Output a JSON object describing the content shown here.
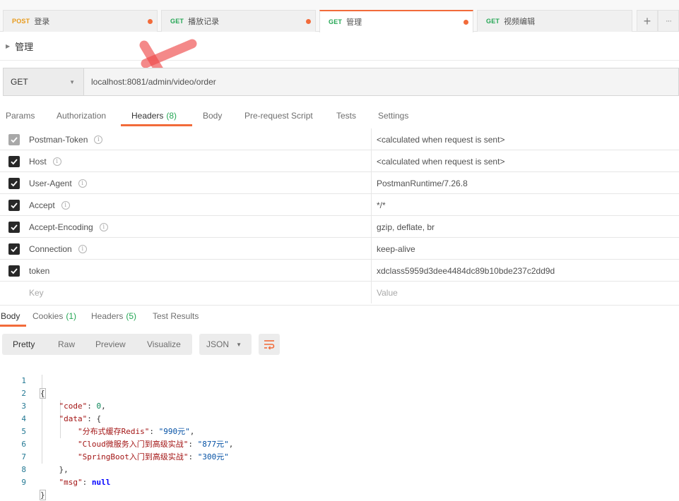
{
  "tabs": [
    {
      "method": "POST",
      "name": "登录",
      "unsaved": true,
      "active": false
    },
    {
      "method": "GET",
      "name": "播放记录",
      "unsaved": true,
      "active": false
    },
    {
      "method": "GET",
      "name": "管理",
      "unsaved": true,
      "active": true
    },
    {
      "method": "GET",
      "name": "视频编辑",
      "unsaved": false,
      "active": false
    }
  ],
  "tab_actions": {
    "add_icon": "+",
    "more_icon": "···"
  },
  "request": {
    "name": "管理",
    "method": "GET",
    "url": "localhost:8081/admin/video/order"
  },
  "request_tabs": [
    {
      "label": "Params",
      "count": ""
    },
    {
      "label": "Authorization",
      "count": ""
    },
    {
      "label": "Headers",
      "count": "(8)"
    },
    {
      "label": "Body",
      "count": ""
    },
    {
      "label": "Pre-request Script",
      "count": ""
    },
    {
      "label": "Tests",
      "count": ""
    },
    {
      "label": "Settings",
      "count": ""
    }
  ],
  "headers": [
    {
      "key": "Postman-Token",
      "value": "<calculated when request is sent>",
      "checked": true,
      "locked": true,
      "info": true
    },
    {
      "key": "Host",
      "value": "<calculated when request is sent>",
      "checked": true,
      "locked": false,
      "info": true
    },
    {
      "key": "User-Agent",
      "value": "PostmanRuntime/7.26.8",
      "checked": true,
      "locked": false,
      "info": true
    },
    {
      "key": "Accept",
      "value": "*/*",
      "checked": true,
      "locked": false,
      "info": true
    },
    {
      "key": "Accept-Encoding",
      "value": "gzip, deflate, br",
      "checked": true,
      "locked": false,
      "info": true
    },
    {
      "key": "Connection",
      "value": "keep-alive",
      "checked": true,
      "locked": false,
      "info": true
    },
    {
      "key": "token",
      "value": "xdclass5959d3dee4484dc89b10bde237c2dd9d",
      "checked": true,
      "locked": false,
      "info": false
    }
  ],
  "headers_placeholder": {
    "key": "Key",
    "value": "Value"
  },
  "response_tabs": [
    {
      "label": "Body",
      "count": ""
    },
    {
      "label": "Cookies",
      "count": "(1)"
    },
    {
      "label": "Headers",
      "count": "(5)"
    },
    {
      "label": "Test Results",
      "count": ""
    }
  ],
  "view_modes": [
    "Pretty",
    "Raw",
    "Preview",
    "Visualize"
  ],
  "format": "JSON",
  "info_icon": "i",
  "colors": {
    "accent": "#f26b3a",
    "get": "#24a654",
    "post": "#e89a1a",
    "count": "#24a654"
  },
  "icons": {
    "wrap": "wrap-lines-icon",
    "check": "check-icon",
    "caret": "caret-right-icon",
    "dropdown": "chevron-down-icon"
  },
  "response_body": {
    "line_numbers": [
      "1",
      "2",
      "3",
      "4",
      "5",
      "6",
      "7",
      "8",
      "9"
    ],
    "open_brace": "{",
    "close_brace": "}",
    "code_key": "\"code\"",
    "code_value": "0",
    "data_key": "\"data\"",
    "data_open": "{",
    "data_close": "},",
    "items": [
      {
        "key": "\"分布式缓存Redis\"",
        "value": "\"990元\""
      },
      {
        "key": "\"Cloud微服务入门到高级实战\"",
        "value": "\"877元\""
      },
      {
        "key": "\"SpringBoot入门到高级实战\"",
        "value": "\"300元\""
      }
    ],
    "msg_key": "\"msg\"",
    "msg_value": "null"
  }
}
